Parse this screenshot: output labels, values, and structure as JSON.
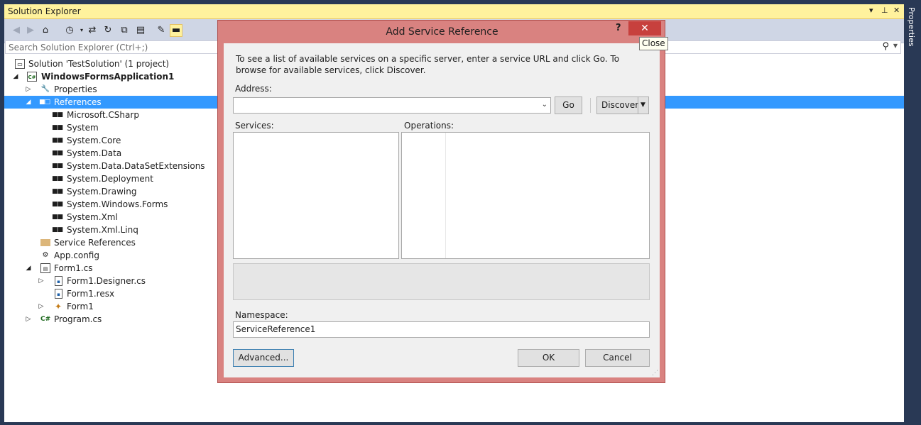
{
  "solution_explorer": {
    "title": "Solution Explorer",
    "title_controls": {
      "dropdown": "▾",
      "pin": "⊥",
      "close": "✕"
    },
    "search_placeholder": "Search Solution Explorer (Ctrl+;)",
    "toolbar_icons": [
      "back-icon",
      "forward-icon",
      "home-icon",
      "history-icon",
      "sync-icon",
      "refresh-icon",
      "collapse-all-icon",
      "show-all-files-icon",
      "properties-icon",
      "preview-icon"
    ],
    "tree": {
      "solution": "Solution 'TestSolution' (1 project)",
      "project": "WindowsFormsApplication1",
      "properties": "Properties",
      "references": "References",
      "reference_items": [
        "Microsoft.CSharp",
        "System",
        "System.Core",
        "System.Data",
        "System.Data.DataSetExtensions",
        "System.Deployment",
        "System.Drawing",
        "System.Windows.Forms",
        "System.Xml",
        "System.Xml.Linq"
      ],
      "service_references": "Service References",
      "app_config": "App.config",
      "form1_cs": "Form1.cs",
      "form1_designer": "Form1.Designer.cs",
      "form1_resx": "Form1.resx",
      "form1": "Form1",
      "program_cs": "Program.cs"
    }
  },
  "properties_strip": {
    "label": "Properties"
  },
  "dialog": {
    "title": "Add Service Reference",
    "help": "?",
    "close_glyph": "✕",
    "close_tooltip": "Close",
    "instructions": "To see a list of available services on a specific server, enter a service URL and click Go. To browse for available services, click Discover.",
    "address_label": "Address:",
    "address_value": "",
    "go_label": "Go",
    "discover_label": "Discover",
    "services_label": "Services:",
    "operations_label": "Operations:",
    "namespace_label": "Namespace:",
    "namespace_value": "ServiceReference1",
    "advanced_label": "Advanced...",
    "ok_label": "OK",
    "cancel_label": "Cancel"
  },
  "colors": {
    "title_bar_yellow": "#fff29d",
    "selection_blue": "#3399ff",
    "dialog_frame": "#d98280",
    "close_red": "#c7403d",
    "background_navy": "#293955"
  }
}
